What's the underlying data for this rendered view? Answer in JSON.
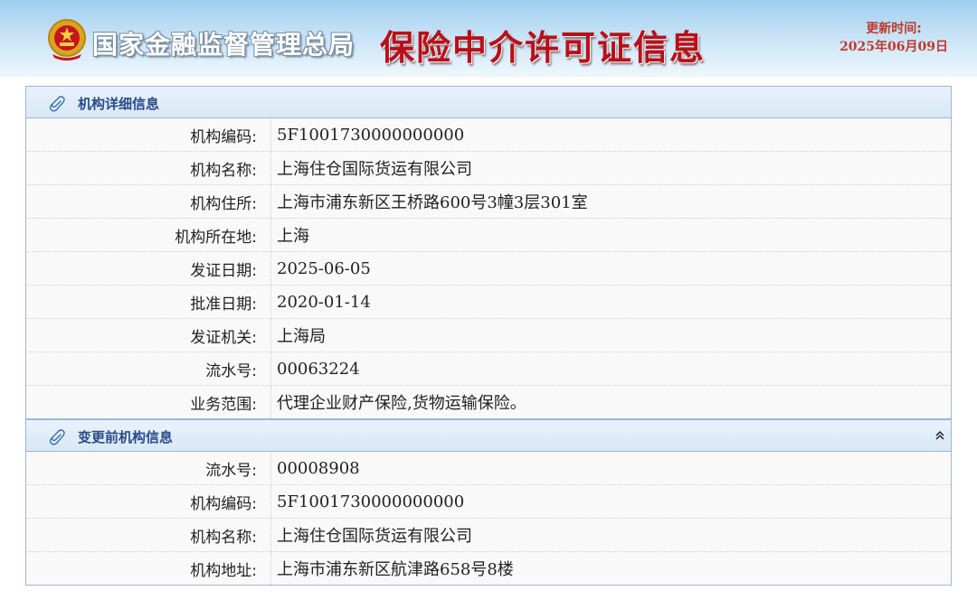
{
  "header": {
    "agency_name": "国家金融监督管理总局",
    "system_title": "保险中介许可证信息",
    "update_label": "更新时间:",
    "update_date": "2025年06月09日",
    "emblem_icon": "national-emblem-icon"
  },
  "colors": {
    "banner_top": "#9fcdef",
    "title_red": "#b8101a",
    "section_title_blue": "#2a4a8a",
    "border_blue": "#9ab8d8"
  },
  "institution_detail": {
    "title": "机构详细信息",
    "icon": "paperclip-icon",
    "rows": [
      {
        "label": "机构编码:",
        "value": "5F1001730000000000"
      },
      {
        "label": "机构名称:",
        "value": "上海住仓国际货运有限公司"
      },
      {
        "label": "机构住所:",
        "value": "上海市浦东新区王桥路600号3幢3层301室"
      },
      {
        "label": "机构所在地:",
        "value": "上海"
      },
      {
        "label": "发证日期:",
        "value": "2025-06-05"
      },
      {
        "label": "批准日期:",
        "value": "2020-01-14"
      },
      {
        "label": "发证机关:",
        "value": "上海局"
      },
      {
        "label": "流水号:",
        "value": "00063224"
      },
      {
        "label": "业务范围:",
        "value": "代理企业财产保险,货物运输保险。"
      }
    ]
  },
  "previous_info": {
    "title": "变更前机构信息",
    "icon": "paperclip-icon",
    "collapse_icon": "double-chevron-up-icon",
    "rows": [
      {
        "label": "流水号:",
        "value": "00008908"
      },
      {
        "label": "机构编码:",
        "value": "5F1001730000000000"
      },
      {
        "label": "机构名称:",
        "value": "上海住仓国际货运有限公司"
      },
      {
        "label": "机构地址:",
        "value": "上海市浦东新区航津路658号8楼"
      }
    ]
  }
}
